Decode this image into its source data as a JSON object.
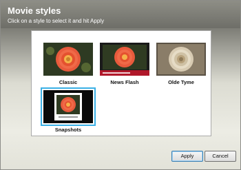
{
  "dialog": {
    "title": "Movie styles",
    "subtitle": "Click on a style to select it and hit Apply"
  },
  "styles": [
    {
      "label": "Classic",
      "selected": false
    },
    {
      "label": "News Flash",
      "selected": false
    },
    {
      "label": "Olde Tyme",
      "selected": false
    },
    {
      "label": "Snapshots",
      "selected": true
    }
  ],
  "buttons": {
    "apply": "Apply",
    "cancel": "Cancel"
  },
  "colors": {
    "selection": "#3ab0e6",
    "flower": "#e8523a",
    "sepia": "#c8b89a"
  }
}
